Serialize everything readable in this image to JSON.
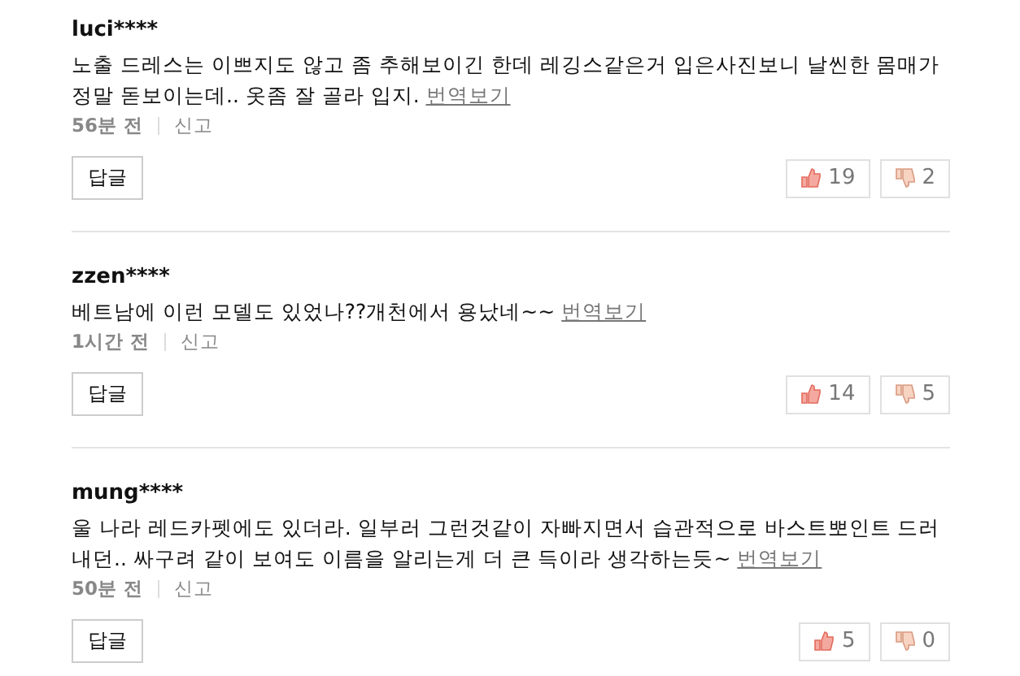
{
  "comments": [
    {
      "user": "luci****",
      "text": "노출 드레스는 이쁘지도 않고 좀 추해보이긴 한데 레깅스같은거 입은사진보니 날씬한 몸매가 정말 돋보이는데.. 옷좀 잘 골라 입지.",
      "translate": "번역보기",
      "time": "56분 전",
      "report": "신고",
      "reply": "답글",
      "likes": "19",
      "dislikes": "2"
    },
    {
      "user": "zzen****",
      "text": "베트남에 이런 모델도 있었나??개천에서 용났네~~",
      "translate": "번역보기",
      "time": "1시간 전",
      "report": "신고",
      "reply": "답글",
      "likes": "14",
      "dislikes": "5"
    },
    {
      "user": "mung****",
      "text": "울 나라 레드카펫에도 있더라. 일부러 그런것같이 자빠지면서 습관적으로 바스트뽀인트 드러내던.. 싸구려 같이 보여도 이름을 알리는게 더 큰 득이라 생각하는듯~",
      "translate": "번역보기",
      "time": "50분 전",
      "report": "신고",
      "reply": "답글",
      "likes": "5",
      "dislikes": "0"
    }
  ]
}
